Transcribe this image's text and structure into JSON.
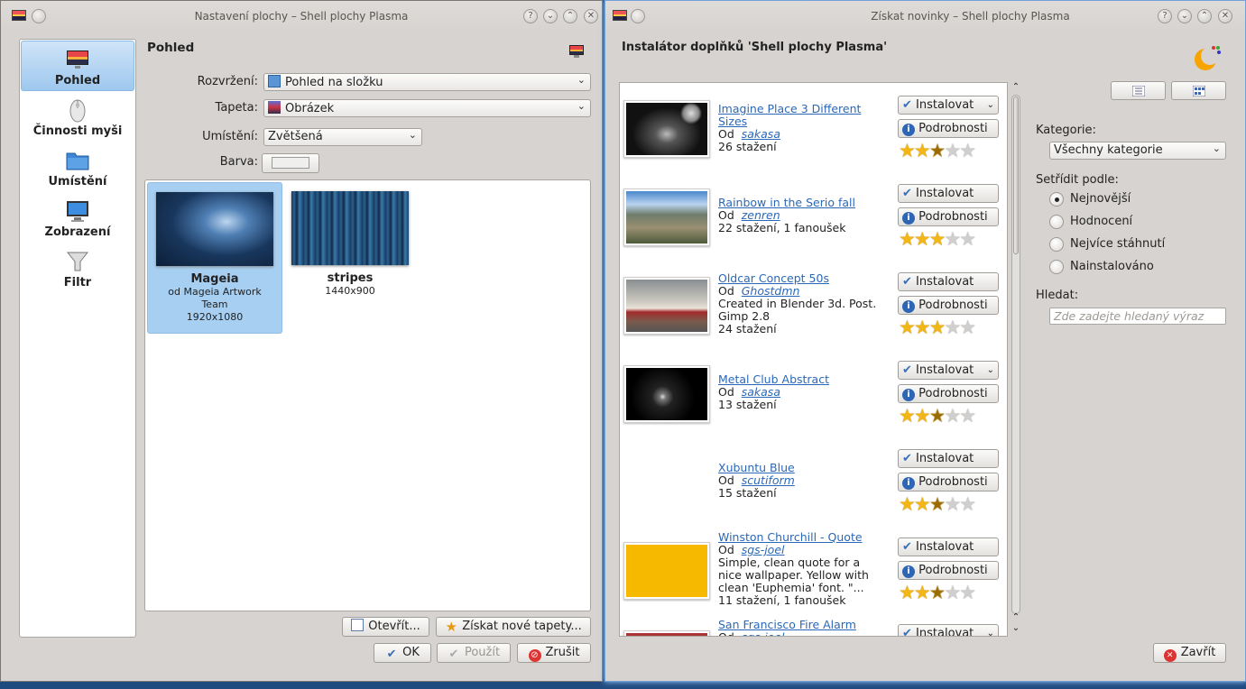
{
  "left_window": {
    "title": "Nastavení plochy – Shell plochy Plasma",
    "sidebar": [
      "Pohled",
      "Činnosti myši",
      "Umístění",
      "Zobrazení",
      "Filtr"
    ],
    "section_title": "Pohled",
    "layout_label": "Rozvržení:",
    "layout_value": "Pohled na složku",
    "wallpaper_label": "Tapeta:",
    "wallpaper_value": "Obrázek",
    "position_label": "Umístění:",
    "position_value": "Zvětšená",
    "color_label": "Barva:",
    "wallpapers": [
      {
        "name": "Mageia",
        "author": "od Mageia Artwork Team",
        "size": "1920x1080",
        "selected": true
      },
      {
        "name": "stripes",
        "author": "",
        "size": "1440x900",
        "selected": false
      }
    ],
    "open_button": "Otevřít...",
    "get_new_button": "Získat nové tapety...",
    "ok_button": "OK",
    "apply_button": "Použít",
    "cancel_button": "Zrušit"
  },
  "right_window": {
    "title": "Získat novinky – Shell plochy Plasma",
    "heading": "Instalátor doplňků 'Shell plochy Plasma'",
    "install_label": "Instalovat",
    "details_label": "Podrobnosti",
    "items": [
      {
        "title": "Imagine Place 3 Different Sizes",
        "by": "Od",
        "author": "sakasa",
        "desc": "26 stažení",
        "rating": 2.5,
        "thumb": "dark-castle"
      },
      {
        "title": "Rainbow in the Serio fall",
        "by": "Od",
        "author": "zenren",
        "desc": "22 stažení, 1 fanoušek",
        "rating": 3,
        "thumb": "mountain-valley"
      },
      {
        "title": "Oldcar Concept 50s",
        "by": "Od",
        "author": "Ghostdmn",
        "desc": "Created in Blender 3d. Post. Gimp 2.8\n24 stažení",
        "rating": 3,
        "thumb": "old-car"
      },
      {
        "title": "Metal Club Abstract",
        "by": "Od",
        "author": "sakasa",
        "desc": "13 stažení",
        "rating": 2.5,
        "thumb": "dark-abstract"
      },
      {
        "title": "Xubuntu Blue",
        "by": "Od",
        "author": "scutiform",
        "desc": "15 stažení",
        "rating": 2.5,
        "thumb": "none"
      },
      {
        "title": "Winston Churchill - Quote",
        "by": "Od",
        "author": "sgs-joel",
        "desc": "Simple, clean quote for a nice wallpaper. Yellow with clean 'Euphemia' font. \"...\n11 stažení, 1 fanoušek",
        "rating": 2.5,
        "thumb": "yellow-quote"
      },
      {
        "title": "San Francisco Fire Alarm",
        "by": "Od",
        "author": "sgs-joel",
        "desc": "",
        "rating": 0,
        "thumb": "fire-alarm"
      }
    ],
    "category_label": "Kategorie:",
    "category_value": "Všechny kategorie",
    "sort_label": "Setřídit podle:",
    "sort_options": [
      "Nejnovější",
      "Hodnocení",
      "Nejvíce stáhnutí",
      "Nainstalováno"
    ],
    "sort_selected": 0,
    "search_label": "Hledat:",
    "search_placeholder": "Zde zadejte hledaný výraz",
    "close_button": "Zavřít"
  }
}
